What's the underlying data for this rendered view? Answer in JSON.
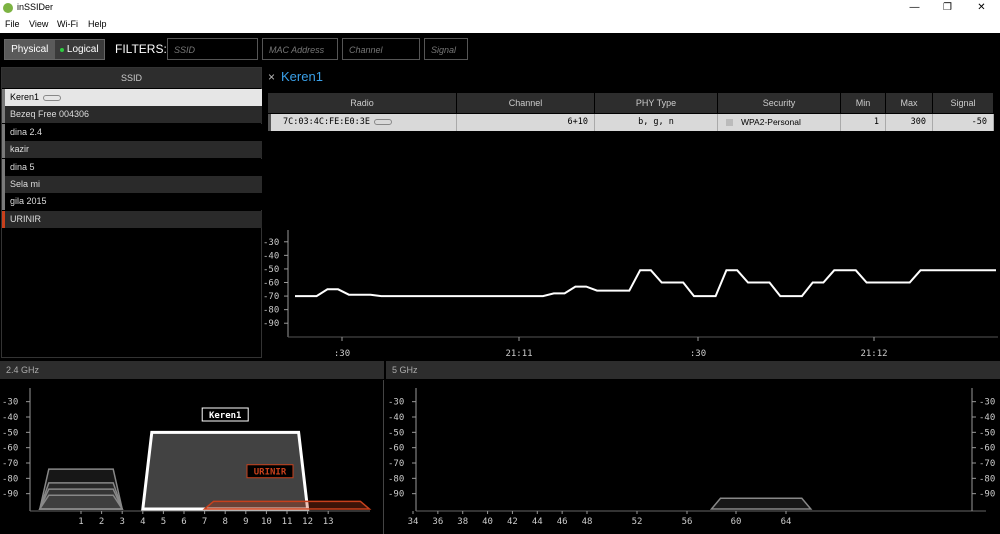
{
  "window": {
    "title": "inSSIDer",
    "minimize": "—",
    "maximize": "❐",
    "close": "✕"
  },
  "menu": [
    "File",
    "View",
    "Wi-Fi",
    "Help"
  ],
  "toolbar": {
    "physical": "Physical",
    "logical": "Logical",
    "filters_label": "FILTERS:",
    "ssid_placeholder": "SSID",
    "mac_placeholder": "MAC Address",
    "channel_placeholder": "Channel",
    "signal_placeholder": "Signal"
  },
  "ssid_list": {
    "header": "SSID",
    "items": [
      {
        "name": "Keren1",
        "selected": true,
        "accent": "#7a7a7a"
      },
      {
        "name": "Bezeq Free 004306",
        "accent": "#7a7a7a"
      },
      {
        "name": "dina 2.4",
        "accent": "#7a7a7a"
      },
      {
        "name": "kazir",
        "accent": "#7a7a7a"
      },
      {
        "name": "dina 5",
        "accent": "#7a7a7a"
      },
      {
        "name": "Sela mi",
        "accent": "#7a7a7a"
      },
      {
        "name": "gila 2015",
        "accent": "#7a7a7a"
      },
      {
        "name": "URINIR",
        "accent": "#c8401c"
      }
    ]
  },
  "detail": {
    "close": "×",
    "title": "Keren1",
    "columns": [
      "Radio",
      "Channel",
      "PHY Type",
      "Security",
      "Min",
      "Max",
      "Signal"
    ],
    "row": {
      "radio": "7C:03:4C:FE:E0:3E",
      "channel": "6+10",
      "phy": "b, g, n",
      "security": "WPA2-Personal",
      "min": "1",
      "max": "300",
      "signal": "-50"
    }
  },
  "colors": {
    "accent": "#3aa0e8",
    "panel": "#2d2d2d",
    "urinir": "#c8401c"
  },
  "chart_data": [
    {
      "type": "line",
      "yticks": [
        "-30",
        "-40",
        "-50",
        "-60",
        "-70",
        "-80",
        "-90"
      ],
      "ylim": [
        -95,
        -25
      ],
      "xtick_labels": [
        ":30",
        "21:11",
        ":30",
        "21:12"
      ],
      "series": [
        {
          "values": [
            -70,
            -70,
            -70,
            -65,
            -65,
            -69,
            -69,
            -69,
            -70,
            -70,
            -70,
            -70,
            -70,
            -70,
            -70,
            -70,
            -70,
            -70,
            -70,
            -70,
            -70,
            -70,
            -70,
            -70,
            -68,
            -68,
            -63,
            -63,
            -66,
            -66,
            -66,
            -66,
            -51,
            -51,
            -60,
            -60,
            -60,
            -70,
            -70,
            -70,
            -51,
            -51,
            -60,
            -60,
            -60,
            -70,
            -70,
            -70,
            -60,
            -60,
            -51,
            -51,
            -51,
            -60,
            -60,
            -60,
            -60,
            -60,
            -51,
            -51,
            -51,
            -51,
            -51,
            -51,
            -51,
            -51
          ]
        }
      ]
    },
    {
      "type": "area",
      "title": "2.4 GHz",
      "yticks": [
        "-30",
        "-40",
        "-50",
        "-60",
        "-70",
        "-80",
        "-90"
      ],
      "ylim": [
        -100,
        -25
      ],
      "xtick_labels": [
        "1",
        "2",
        "3",
        "4",
        "5",
        "6",
        "7",
        "8",
        "9",
        "10",
        "11",
        "12",
        "13"
      ],
      "networks": [
        {
          "label": "Keren1",
          "ch_start": 4,
          "ch_end": 12,
          "signal": -50
        },
        {
          "label": "URINIR",
          "ch_start": 7,
          "ch_end": 15,
          "signal": -95
        },
        {
          "ch_start": -1,
          "ch_end": 3,
          "signal": -74
        },
        {
          "ch_start": -1,
          "ch_end": 3,
          "signal": -83
        },
        {
          "ch_start": -1,
          "ch_end": 3,
          "signal": -87
        },
        {
          "ch_start": -1,
          "ch_end": 3,
          "signal": -91
        }
      ]
    },
    {
      "type": "area",
      "title": "5 GHz",
      "yticks": [
        "-30",
        "-40",
        "-50",
        "-60",
        "-70",
        "-80",
        "-90"
      ],
      "ylim": [
        -100,
        -25
      ],
      "xtick_labels": [
        "34",
        "36",
        "38",
        "40",
        "42",
        "44",
        "46",
        "48",
        "52",
        "56",
        "60",
        "64"
      ],
      "networks": [
        {
          "ch_start": 58,
          "ch_end": 66,
          "signal": -93
        }
      ]
    }
  ]
}
